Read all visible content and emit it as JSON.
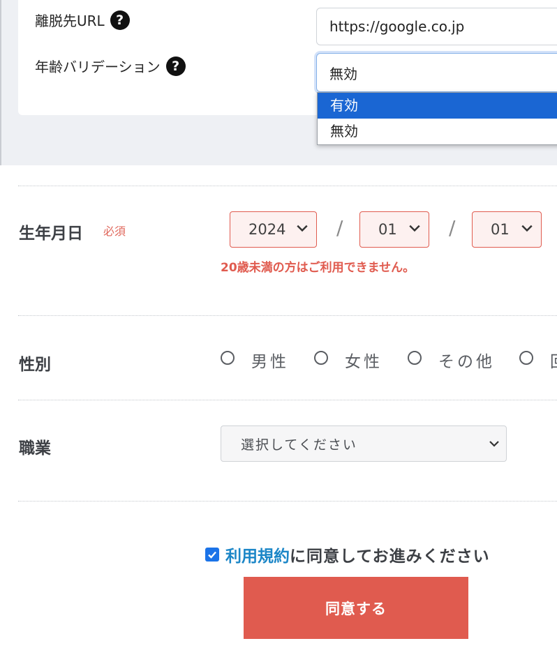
{
  "settings": {
    "exit_url_label": "離脱先URL",
    "exit_url_value": "https://google.co.jp",
    "age_validation_label": "年齢バリデーション",
    "age_validation_selected": "無効",
    "age_validation_options": [
      "有効",
      "無効"
    ],
    "help_glyph": "?"
  },
  "form": {
    "birthdate": {
      "label": "生年月日",
      "required_badge": "必須",
      "year": "2024",
      "month": "01",
      "day": "01",
      "separator": "/",
      "error": "20歳未満の方はご利用できません。"
    },
    "gender": {
      "label": "性別",
      "options": [
        "男性",
        "女性",
        "その他",
        "回"
      ]
    },
    "occupation": {
      "label": "職業",
      "placeholder": "選択してください"
    },
    "agreement": {
      "link_text": "利用規約",
      "text": "に同意してお進みください",
      "checked": true,
      "button_label": "同意する"
    }
  },
  "colors": {
    "accent_red": "#e05b4f",
    "link_blue": "#1b86c7",
    "dropdown_highlight": "#1a66d3"
  }
}
